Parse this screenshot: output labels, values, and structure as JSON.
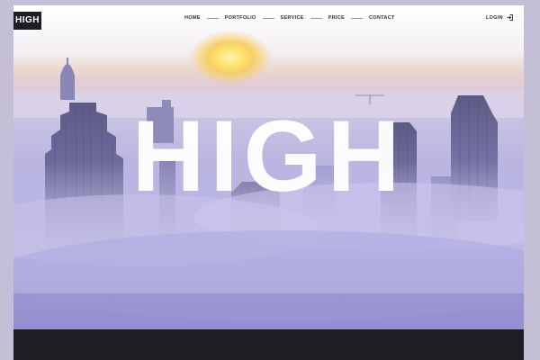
{
  "brand": {
    "logo_text": "HIGH"
  },
  "nav": {
    "items": [
      {
        "label": "HOME"
      },
      {
        "label": "PORTFOLIO"
      },
      {
        "label": "SERVICE"
      },
      {
        "label": "PRICE"
      },
      {
        "label": "CONTACT"
      }
    ],
    "login_label": "LOGIN"
  },
  "hero": {
    "title": "HIGH"
  },
  "colors": {
    "logo_bg": "#1e1e22",
    "footer_bar": "#1d1d24",
    "nav_text": "#333333",
    "sky_top": "#f4f0f4",
    "fog": "#b4afe0"
  },
  "icons": {
    "login": "login-arrow-icon"
  }
}
